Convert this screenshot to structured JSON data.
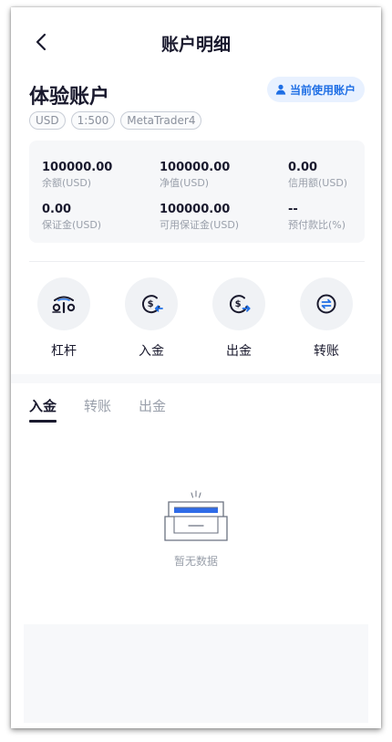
{
  "header": {
    "title": "账户明细",
    "back_icon": "chevron-left-icon"
  },
  "account": {
    "name": "体验账户",
    "current_badge": "当前使用账户",
    "tags": [
      "USD",
      "1:500",
      "MetaTrader4"
    ]
  },
  "stats": [
    {
      "value": "100000.00",
      "label": "余额(USD)"
    },
    {
      "value": "100000.00",
      "label": "净值(USD)"
    },
    {
      "value": "0.00",
      "label": "信用额(USD)"
    },
    {
      "value": "0.00",
      "label": "保证金(USD)"
    },
    {
      "value": "100000.00",
      "label": "可用保证金(USD)"
    },
    {
      "value": "--",
      "label": "预付款比(%)"
    }
  ],
  "actions": [
    {
      "label": "杠杆",
      "icon": "leverage-icon"
    },
    {
      "label": "入金",
      "icon": "deposit-icon"
    },
    {
      "label": "出金",
      "icon": "withdraw-icon"
    },
    {
      "label": "转账",
      "icon": "transfer-icon"
    }
  ],
  "tabs": [
    {
      "label": "入金",
      "active": true
    },
    {
      "label": "转账",
      "active": false
    },
    {
      "label": "出金",
      "active": false
    }
  ],
  "empty": {
    "text": "暂无数据",
    "icon": "empty-box-icon"
  },
  "colors": {
    "accent": "#1f6fe5",
    "badge_bg": "#e8f1ff",
    "text_dark": "#1a1a2e",
    "text_muted": "#9aa0ab"
  }
}
